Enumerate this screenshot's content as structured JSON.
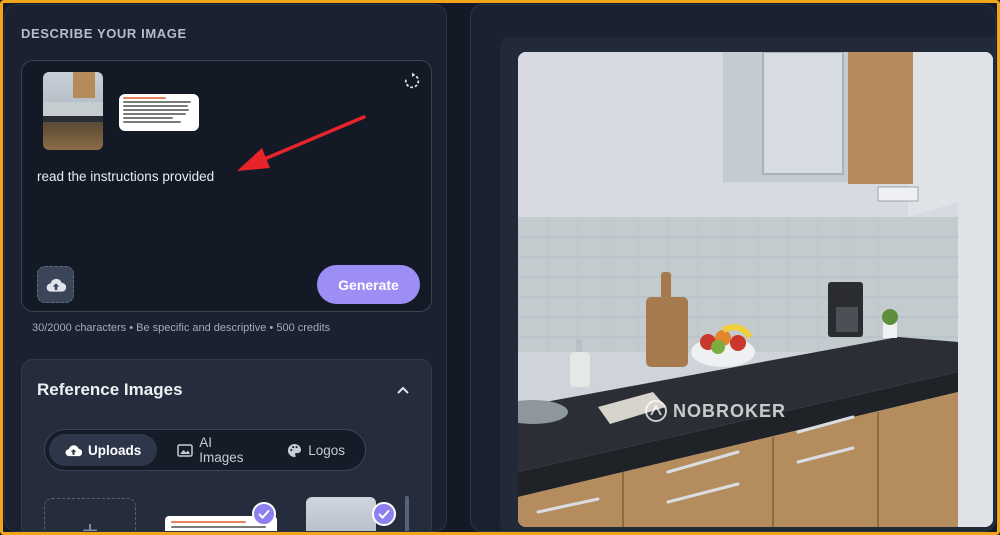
{
  "describe": {
    "heading": "DESCRIBE YOUR IMAGE",
    "prompt_text": "read the instructions provided",
    "generate_label": "Generate",
    "char_info": "30/2000 characters • Be specific and descriptive • 500 credits"
  },
  "reference": {
    "title": "Reference Images",
    "tabs": [
      {
        "label": "Uploads",
        "icon": "cloud-upload-icon",
        "active": true
      },
      {
        "label": "AI Images",
        "icon": "image-icon",
        "active": false
      },
      {
        "label": "Logos",
        "icon": "palette-icon",
        "active": false
      }
    ]
  },
  "preview": {
    "watermark": "NOBROKER"
  },
  "colors": {
    "accent": "#9d8ef5",
    "annotation_arrow": "#e8232a",
    "frame_border": "#f2a51a"
  }
}
